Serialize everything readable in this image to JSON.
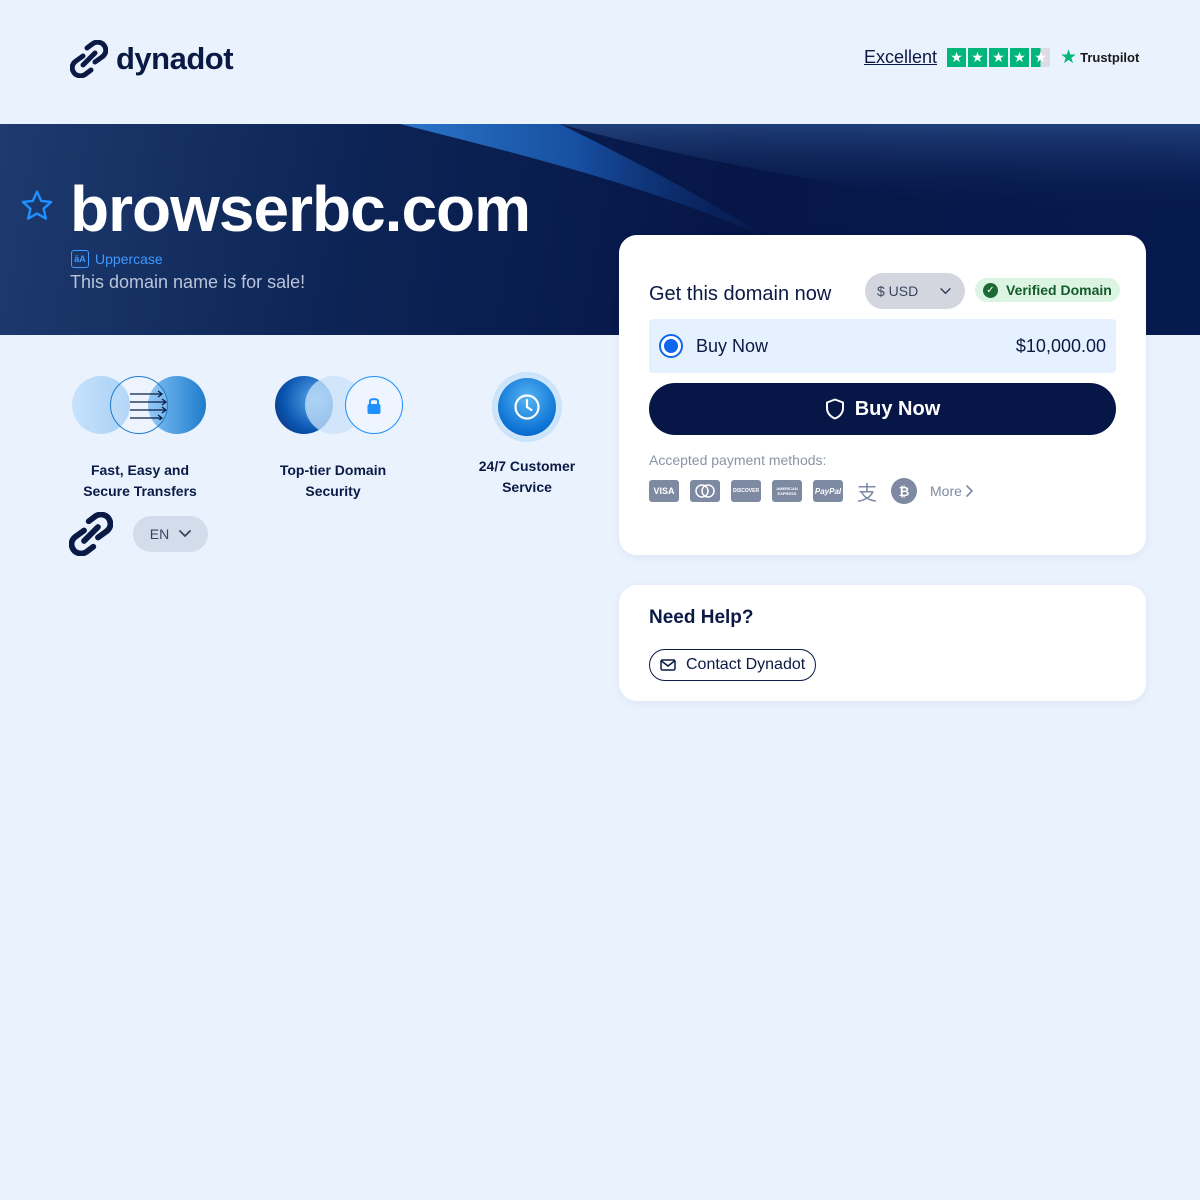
{
  "header": {
    "brand": "dynadot",
    "rating_text": "Excellent",
    "rating_stars": 4.5,
    "trustpilot_label": "Trustpilot"
  },
  "hero": {
    "domain": "browserbc.com",
    "tag_label": "Uppercase",
    "tag_icon_text": "āA",
    "subtitle": "This domain name is for sale!"
  },
  "features": [
    {
      "label_line1": "Fast, Easy and",
      "label_line2": "Secure Transfers",
      "icon": "transfer-icon"
    },
    {
      "label_line1": "Top-tier Domain",
      "label_line2": "Security",
      "icon": "lock-icon"
    },
    {
      "label_line1": "24/7 Customer",
      "label_line2": "Service",
      "icon": "clock-icon"
    }
  ],
  "footer": {
    "language": "EN"
  },
  "purchase": {
    "title": "Get this domain now",
    "currency": "$ USD",
    "verified_label": "Verified Domain",
    "option_label": "Buy Now",
    "option_price": "$10,000.00",
    "buy_button_label": "Buy Now",
    "payment_label": "Accepted payment methods:",
    "payment_methods": [
      "VISA",
      "MASTERCARD",
      "DISCOVER",
      "AMERICAN EXPRESS",
      "PayPal",
      "Alipay",
      "Bitcoin"
    ],
    "more_label": "More"
  },
  "help": {
    "title": "Need Help?",
    "contact_label": "Contact Dynadot"
  },
  "colors": {
    "background": "#eaf2fe",
    "navy": "#061647",
    "accent_blue": "#1166ee",
    "trustpilot_green": "#00b67a",
    "verified_green": "#1a6b33"
  }
}
